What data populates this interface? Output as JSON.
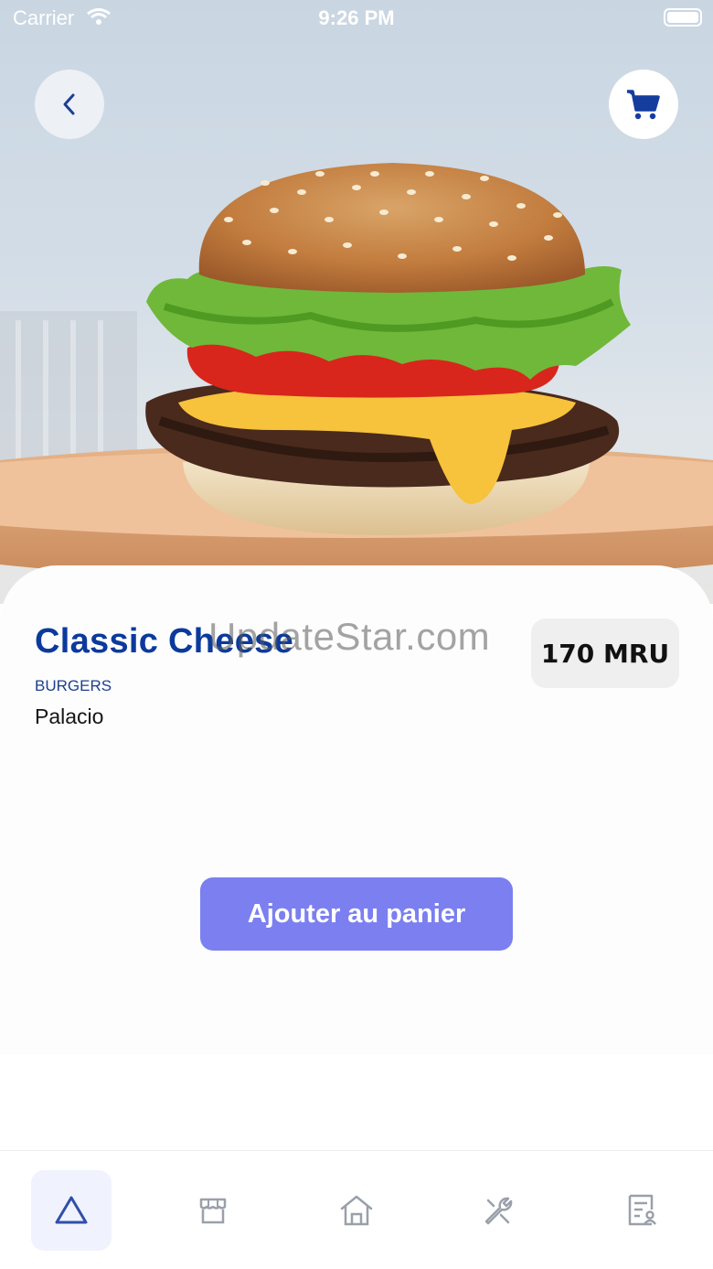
{
  "status_bar": {
    "carrier": "Carrier",
    "time": "9:26 PM"
  },
  "product": {
    "name": "Classic Cheese",
    "category": "BURGERS",
    "restaurant": "Palacio",
    "price": "170 MRU"
  },
  "watermark": "UpdateStar.com",
  "actions": {
    "add_to_cart_label": "Ajouter au panier"
  },
  "icons": {
    "back": "chevron-left-icon",
    "cart": "shopping-cart-icon",
    "tabs": [
      "triangle-icon",
      "storefront-icon",
      "home-icon",
      "wrench-icon",
      "document-user-icon"
    ]
  },
  "colors": {
    "title": "#0c3a9c",
    "accent_button": "#7b7ff0",
    "price_bg": "#efefef",
    "active_tab_bg": "#f0f3fd",
    "tab_icon_inactive": "#9aa0aa",
    "tab_icon_active": "#2f4fa8"
  },
  "tab_bar": {
    "active_index": 0
  }
}
